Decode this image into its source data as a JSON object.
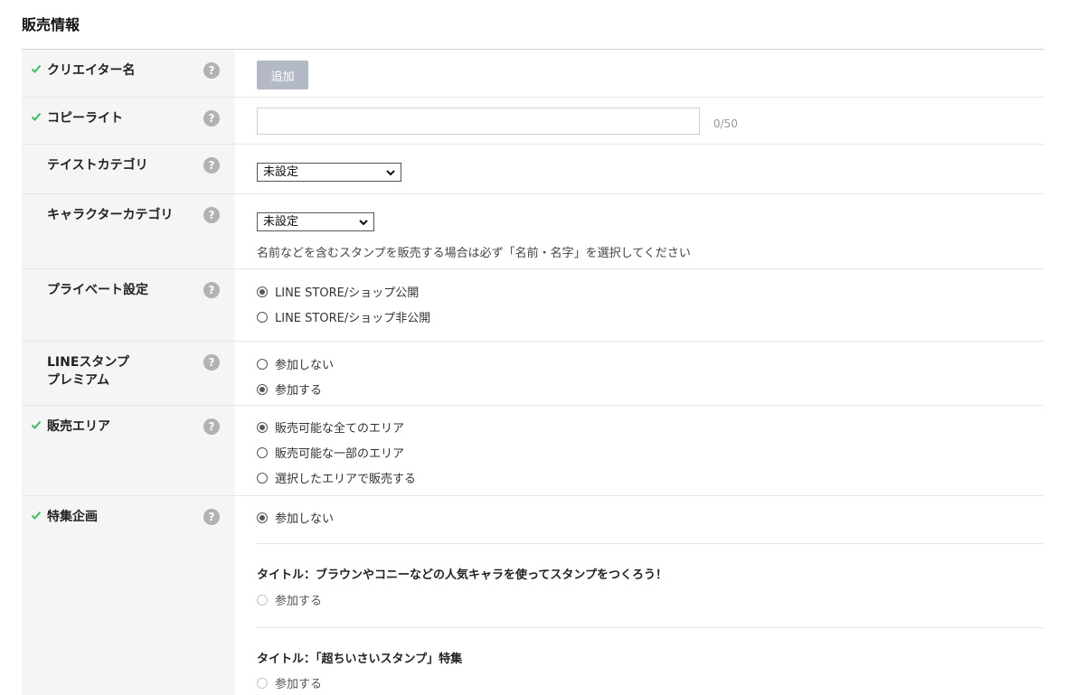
{
  "section": {
    "title": "販売情報"
  },
  "rows": {
    "creator": {
      "label": "クリエイター名",
      "add_label": "追加"
    },
    "copyright": {
      "label": "コピーライト",
      "value": "",
      "counter": "0/50"
    },
    "taste": {
      "label": "テイストカテゴリ",
      "selected": "未設定"
    },
    "character": {
      "label": "キャラクターカテゴリ",
      "selected": "未設定",
      "note": "名前などを含むスタンプを販売する場合は必ず「名前・名字」を選択してください"
    },
    "private": {
      "label": "プライベート設定",
      "options": [
        "LINE STORE/ショップ公開",
        "LINE STORE/ショップ非公開"
      ],
      "selected": 0
    },
    "premium": {
      "label_line1": "LINEスタンプ",
      "label_line2": "プレミアム",
      "options": [
        "参加しない",
        "参加する"
      ],
      "selected": 1
    },
    "area": {
      "label": "販売エリア",
      "options": [
        "販売可能な全てのエリア",
        "販売可能な一部のエリア",
        "選択したエリアで販売する"
      ],
      "selected": 0
    },
    "feature": {
      "label": "特集企画",
      "none_option": "参加しない",
      "campaigns": [
        {
          "title": "タイトル：ブラウンやコニーなどの人気キャラを使ってスタンプをつくろう！",
          "option": "参加する"
        },
        {
          "title": "タイトル：「超ちいさいスタンプ」特集",
          "option": "参加する"
        }
      ]
    }
  },
  "help_glyph": "?",
  "colors": {
    "check": "#3abf5a",
    "help": "#b2b2b2",
    "add_button": "#b3bac5",
    "label_bg": "#f5f5f5"
  }
}
